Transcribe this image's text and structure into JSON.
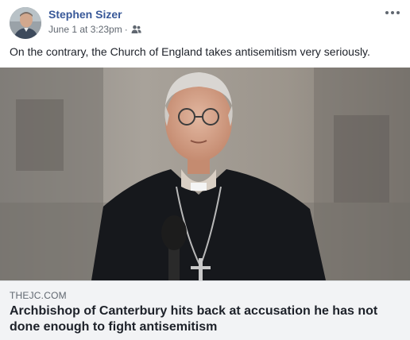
{
  "post": {
    "author": "Stephen Sizer",
    "timestamp": "June 1 at 3:23pm",
    "separator": "·",
    "audience_icon": "friends-icon",
    "more_icon": "more-options-icon",
    "text": "On the contrary, the Church of England takes antisemitism very seriously."
  },
  "link": {
    "domain": "THEJC.COM",
    "headline": "Archbishop of Canterbury hits back at accusation he has not done enough to fight antisemitism",
    "image_icon": "article-photo"
  },
  "colors": {
    "author_link": "#385898",
    "meta_text": "#606770",
    "body_text": "#1d2129",
    "preview_background": "#f2f3f5"
  }
}
